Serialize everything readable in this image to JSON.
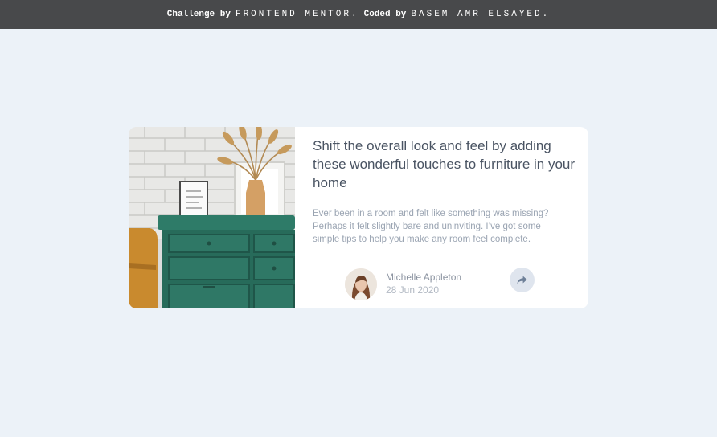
{
  "attribution": {
    "prefix": "Challenge by",
    "mentor": "FRONTEND MENTOR.",
    "coded_by": "Coded by",
    "author": "BASEM AMR ELSAYED."
  },
  "card": {
    "title": "Shift the overall look and feel by adding these wonderful touches to furniture in your home",
    "description": "Ever been in a room and felt like something was missing? Perhaps it felt slightly bare and uninviting. I’ve got some simple tips to help you make any room feel complete.",
    "author_name": "Michelle Appleton",
    "date": "28 Jun 2020"
  },
  "colors": {
    "page_background": "#ecf2f8",
    "topbar_background": "#48494b",
    "title_text": "#4a5463",
    "body_text": "#9aa4b2",
    "share_button": "#dfe5ee",
    "dresser_green": "#2f7866"
  },
  "icons": {
    "share": "share-icon"
  }
}
